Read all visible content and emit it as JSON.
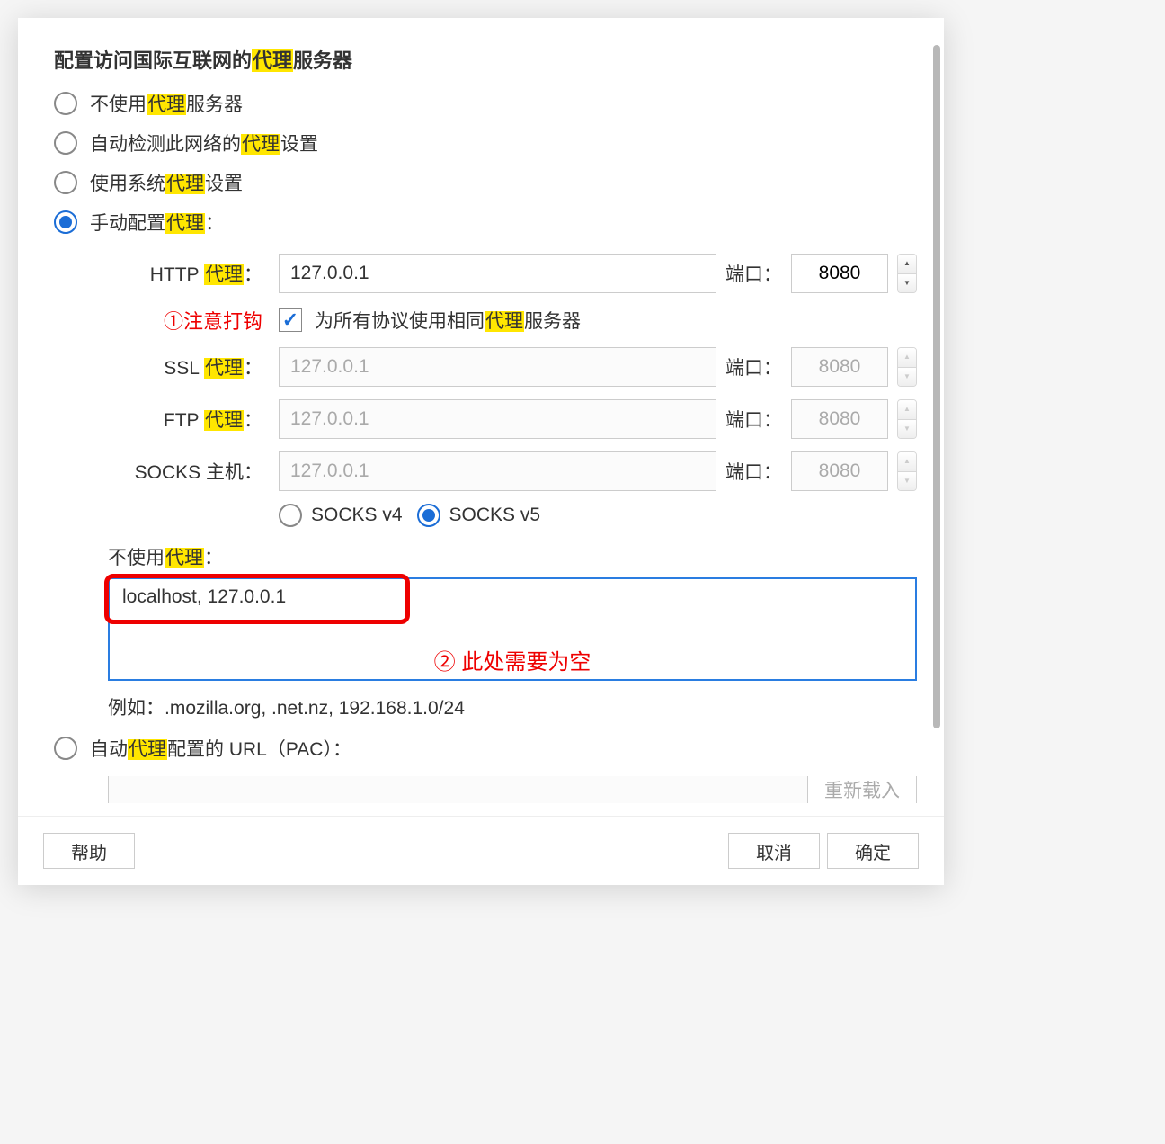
{
  "heading": {
    "pre": "配置访问国际互联网的",
    "hl": "代理",
    "post": "服务器"
  },
  "radios": {
    "noproxy": {
      "pre": "不使用",
      "hl": "代理",
      "post": "服务器"
    },
    "autodetect": {
      "pre": "自动检测此网络的",
      "hl": "代理",
      "post": "设置"
    },
    "system": {
      "pre": "使用系统",
      "hl": "代理",
      "post": "设置"
    },
    "manual": {
      "pre": "手动配置",
      "hl": "代理",
      "post": "："
    },
    "pac": {
      "pre": "自动",
      "hl": "代理",
      "post": "配置的 URL（PAC）："
    }
  },
  "fields": {
    "http": {
      "label_pre": "HTTP ",
      "label_hl": "代理",
      "label_post": "：",
      "value": "127.0.0.1",
      "port": "8080"
    },
    "ssl": {
      "label_pre": "SSL ",
      "label_hl": "代理",
      "label_post": "：",
      "value": "127.0.0.1",
      "port": "8080"
    },
    "ftp": {
      "label_pre": "FTP ",
      "label_hl": "代理",
      "label_post": "：",
      "value": "127.0.0.1",
      "port": "8080"
    },
    "socks": {
      "label": "SOCKS 主机：",
      "value": "127.0.0.1",
      "port": "8080"
    }
  },
  "port_label": "端口：",
  "same_for_all": {
    "pre": "为所有协议使用相同",
    "hl": "代理",
    "post": "服务器"
  },
  "socks_v4": "SOCKS v4",
  "socks_v5": "SOCKS v5",
  "no_proxy": {
    "label_pre": "不使用",
    "label_hl": "代理",
    "label_post": "：",
    "value": "localhost, 127.0.0.1",
    "example": "例如：.mozilla.org, .net.nz, 192.168.1.0/24"
  },
  "annotations": {
    "note1": "①注意打钩",
    "note2": "② 此处需要为空"
  },
  "reload_label": "重新载入",
  "buttons": {
    "help": "帮助",
    "cancel": "取消",
    "ok": "确定"
  }
}
